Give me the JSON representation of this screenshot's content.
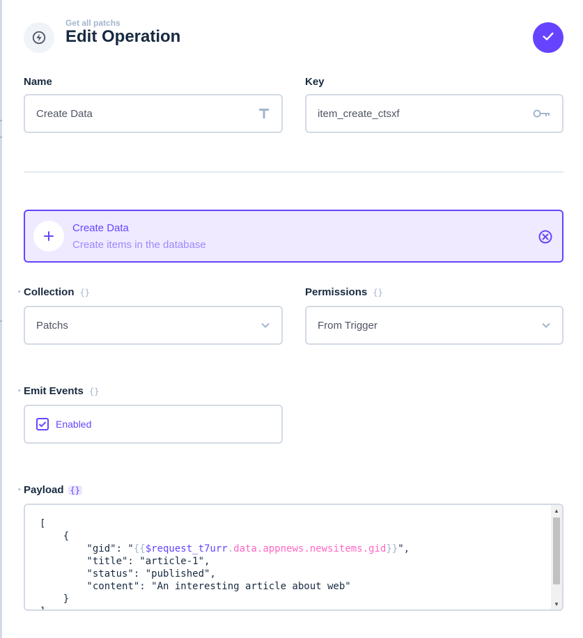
{
  "header": {
    "breadcrumb": "Get all patchs",
    "title": "Edit Operation",
    "icon": "bolt-icon",
    "save_icon": "check-icon"
  },
  "fields": {
    "name": {
      "label": "Name",
      "value": "Create Data",
      "icon": "text-type-icon"
    },
    "key": {
      "label": "Key",
      "value": "item_create_ctsxf",
      "icon": "key-icon"
    }
  },
  "operation": {
    "title": "Create Data",
    "subtitle": "Create items in the database",
    "icon": "plus-icon",
    "close_icon": "close-circle-icon"
  },
  "collection": {
    "label": "Collection",
    "value": "Patchs",
    "badge": "{}"
  },
  "permissions": {
    "label": "Permissions",
    "value": "From Trigger",
    "badge": "{}"
  },
  "emit_events": {
    "label": "Emit Events",
    "badge": "{}",
    "checkbox_label": "Enabled",
    "checked": true
  },
  "payload": {
    "label": "Payload",
    "badge": "{}",
    "lines": {
      "l0": "[",
      "l1": "    {",
      "l2_key": "        \"gid\": \"",
      "l2_open": "{{",
      "l2_var": "$request_t7urr",
      "l2_dot": ".",
      "l2_path": "data.appnews.newsitems.gid",
      "l2_close": "}}",
      "l2_end": "\",",
      "l3": "        \"title\": \"article-1\",",
      "l4": "        \"status\": \"published\",",
      "l5": "        \"content\": \"An interesting article about web\"",
      "l6": "    }",
      "l7": "]"
    }
  },
  "colors": {
    "accent": "#6644ff",
    "accent_bg": "#efeaff",
    "border": "#d3dae4",
    "muted": "#a2b5cd",
    "text": "#172940",
    "path": "#ff66c4"
  }
}
